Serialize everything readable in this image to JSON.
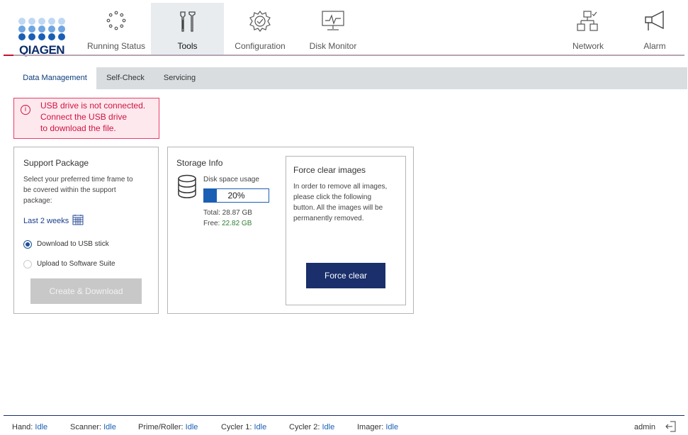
{
  "header": {
    "brand": "QIAGEN",
    "nav": [
      {
        "label": "Running Status",
        "icon": "running-status-icon"
      },
      {
        "label": "Tools",
        "icon": "tools-icon",
        "active": true
      },
      {
        "label": "Configuration",
        "icon": "configuration-icon"
      },
      {
        "label": "Disk Monitor",
        "icon": "disk-monitor-icon"
      },
      {
        "label": "Network",
        "icon": "network-icon"
      },
      {
        "label": "Alarm",
        "icon": "alarm-icon"
      }
    ]
  },
  "tabs": [
    {
      "label": "Data Management",
      "active": true
    },
    {
      "label": "Self-Check"
    },
    {
      "label": "Servicing"
    }
  ],
  "alert": {
    "line1": "USB drive is not connected.",
    "line2": "Connect the USB drive",
    "line3": "to download the file."
  },
  "support": {
    "title": "Support Package",
    "desc1": "Select your preferred time frame to",
    "desc2": "be covered within the support",
    "desc3": "package:",
    "timeframe": "Last 2 weeks",
    "option_usb": "Download to USB stick",
    "option_suite": "Upload to Software Suite",
    "button": "Create & Download"
  },
  "storage": {
    "title": "Storage Info",
    "usage_label": "Disk space usage",
    "usage_percent": "20%",
    "usage_fraction": 0.2,
    "total": "Total: 28.87 GB",
    "free_label": "Free:",
    "free_value": "22.82 GB"
  },
  "force": {
    "title": "Force clear images",
    "desc1": "In order to remove all images,",
    "desc2": "please click the following",
    "desc3": "button. All the images will be",
    "desc4": "permanently removed.",
    "button": "Force clear"
  },
  "status": [
    {
      "label": "Hand:",
      "value": "Idle"
    },
    {
      "label": "Scanner:",
      "value": "Idle"
    },
    {
      "label": "Prime/Roller:",
      "value": "Idle"
    },
    {
      "label": "Cycler 1:",
      "value": "Idle"
    },
    {
      "label": "Cycler 2:",
      "value": "Idle"
    },
    {
      "label": "Imager:",
      "value": "Idle"
    }
  ],
  "user": "admin",
  "colors": {
    "accent": "#1a2f6b",
    "alert": "#d01443",
    "free": "#2e7d32"
  }
}
